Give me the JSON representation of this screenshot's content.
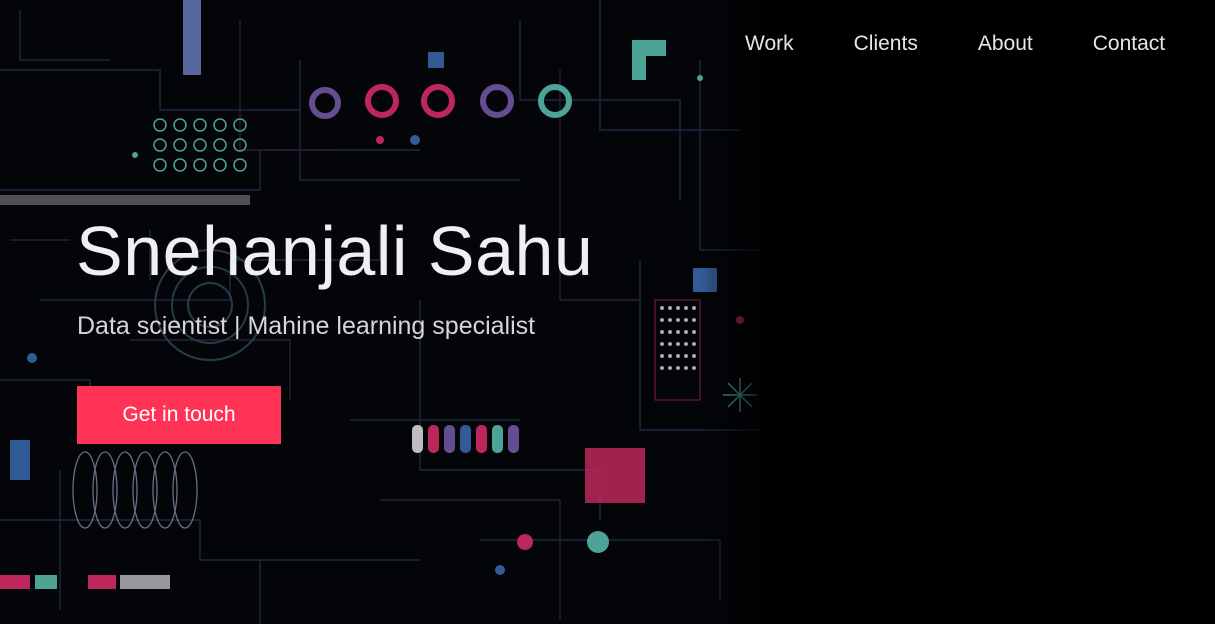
{
  "nav": {
    "items": [
      {
        "label": "Work"
      },
      {
        "label": "Clients"
      },
      {
        "label": "About"
      },
      {
        "label": "Contact"
      }
    ]
  },
  "hero": {
    "title": "Snehanjali Sahu",
    "subtitle": "Data scientist | Mahine learning specialist",
    "cta_label": "Get in touch",
    "background_image": "circuit-board-illustration",
    "colors": {
      "background": "#000000",
      "accent": "#ff3355",
      "pink": "#e8306f",
      "teal": "#5ec8b8",
      "blue": "#3e6fb8",
      "purple": "#7a5fb0",
      "line": "#1f3550"
    }
  }
}
